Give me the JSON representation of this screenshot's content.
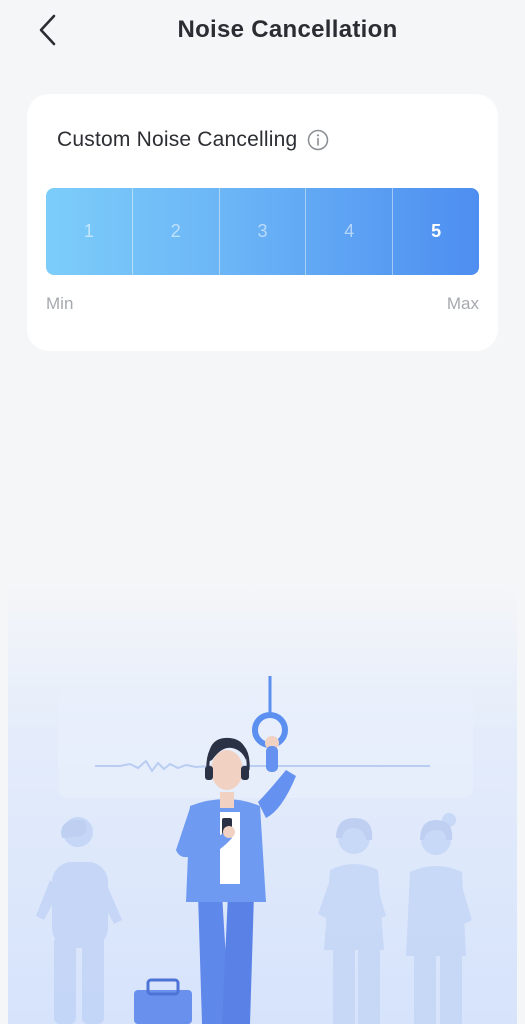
{
  "header": {
    "title": "Noise Cancellation",
    "back_icon": "chevron-left-icon"
  },
  "card": {
    "title": "Custom Noise Cancelling",
    "info_icon": "info-icon",
    "levels": [
      "1",
      "2",
      "3",
      "4",
      "5"
    ],
    "selected_level": 5,
    "min_label": "Min",
    "max_label": "Max"
  },
  "colors": {
    "accent_start": "#7ccdfa",
    "accent_end": "#4d8ef0",
    "background": "#f5f6f8",
    "card": "#ffffff"
  }
}
